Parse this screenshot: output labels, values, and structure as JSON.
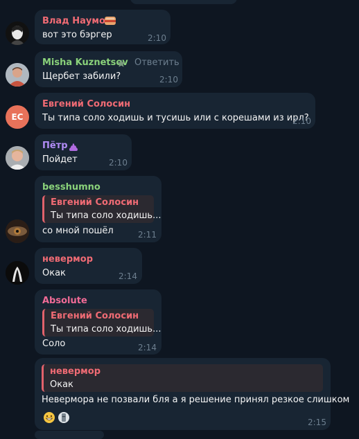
{
  "colors": {
    "background": "#0e1621",
    "bubble": "#182533",
    "time": "#6d7f8f",
    "name_red": "#f06b74",
    "name_green": "#8ad27a",
    "name_purple": "#b18cf5",
    "name_pink": "#f06b96",
    "reply_accent": "#e2626b",
    "reply_bg": "#2b2930"
  },
  "messages": [
    {
      "author": "Влад Наумов",
      "text": "вот это бэргер",
      "time": "2:10",
      "avatar": "portrait-dark",
      "badge": "burger-emoji"
    },
    {
      "author": "Misha Kuznetsov",
      "action": "Ответить",
      "text": "Щербет забили?",
      "time": "2:10",
      "avatar": "photo-person",
      "badge": "star-icon"
    },
    {
      "author": "Евгений Солосин",
      "text": "Ты типа соло ходишь и тусишь или с корешами из ирл?",
      "time": "2:10",
      "avatar_initials": "ЕС"
    },
    {
      "author": "Пётр",
      "text": "Пойдет",
      "time": "2:10",
      "avatar": "photo-person",
      "badge": "poop-emoji"
    },
    {
      "author": "besshumno",
      "reply_author": "Евгений Солосин",
      "reply_text": "Ты типа соло ходишь...",
      "text": "со мной пошёл",
      "time": "2:11",
      "avatar": "eye-closeup"
    },
    {
      "author": "невермор",
      "text": "Окак",
      "time": "2:14",
      "avatar": "dark-figure"
    },
    {
      "author": "Absolute",
      "reply_author": "Евгений Солосин",
      "reply_text": "Ты типа соло ходишь...",
      "text": "Соло",
      "time": "2:14"
    },
    {
      "reply_author": "невермор",
      "reply_text": "Окак",
      "text": "Невермора не позвали бля а я решение принял резкое слишком",
      "time": "2:15",
      "reactions": [
        "grin-emoji",
        "moai-emoji"
      ]
    }
  ]
}
